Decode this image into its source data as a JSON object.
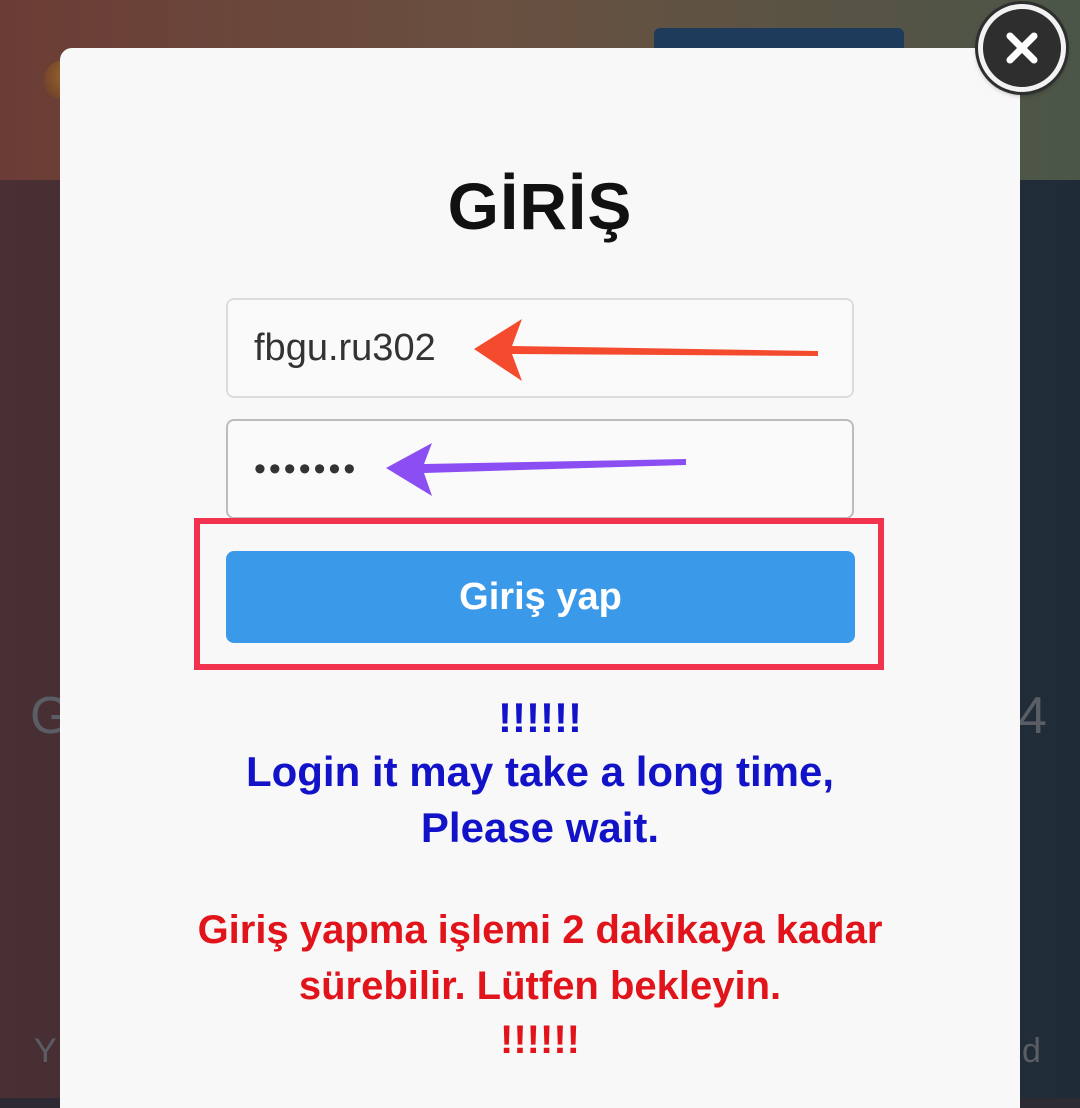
{
  "background": {
    "left_letter": "G",
    "right_letter": "4",
    "left_small": "Y",
    "right_small": "d"
  },
  "modal": {
    "close_icon": "close-icon",
    "title": "GİRİŞ",
    "username_value": "fbgu.ru302",
    "password_value": "•••••••",
    "login_button_label": "Giriş yap",
    "notice_marks_top": "!!!!!!",
    "notice_en_line1": "Login it may take a long time,",
    "notice_en_line2": "Please wait.",
    "notice_tr_line1": "Giriş yapma işlemi 2 dakikaya kadar",
    "notice_tr_line2": "sürebilir. Lütfen bekleyin.",
    "notice_marks_bottom": "!!!!!!"
  },
  "colors": {
    "accent_button": "#3b99ea",
    "highlight_box": "#f2334f",
    "arrow_username": "#f44a2e",
    "arrow_password": "#8a4ef2",
    "notice_blue": "#1212c9",
    "notice_red": "#e0141a"
  }
}
